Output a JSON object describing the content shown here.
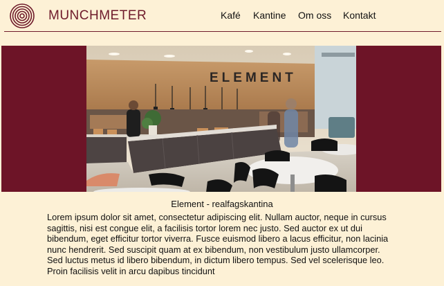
{
  "header": {
    "brand": "MUNCHMETER",
    "nav": [
      {
        "label": "Kafé"
      },
      {
        "label": "Kantine"
      },
      {
        "label": "Om oss"
      },
      {
        "label": "Kontakt"
      }
    ]
  },
  "hero": {
    "sign_text": "ELEMENT",
    "caption": "Element - realfagskantina"
  },
  "article": {
    "text": "Lorem ipsum dolor sit amet, consectetur adipiscing elit. Nullam auctor, neque in cursus sagittis, nisi est congue elit, a facilisis tortor lorem nec justo. Sed auctor ex ut dui bibendum, eget efficitur tortor viverra. Fusce euismod libero a lacus efficitur, non lacinia nunc hendrerit. Sed suscipit quam at ex bibendum, non vestibulum justo ullamcorper. Sed luctus metus id libero bibendum, in dictum libero tempus. Sed vel scelerisque leo. Proin facilisis velit in arcu dapibus tincidunt"
  },
  "colors": {
    "background": "#fdf1d6",
    "accent": "#6e1a2a",
    "hero_band": "#6d1427"
  }
}
